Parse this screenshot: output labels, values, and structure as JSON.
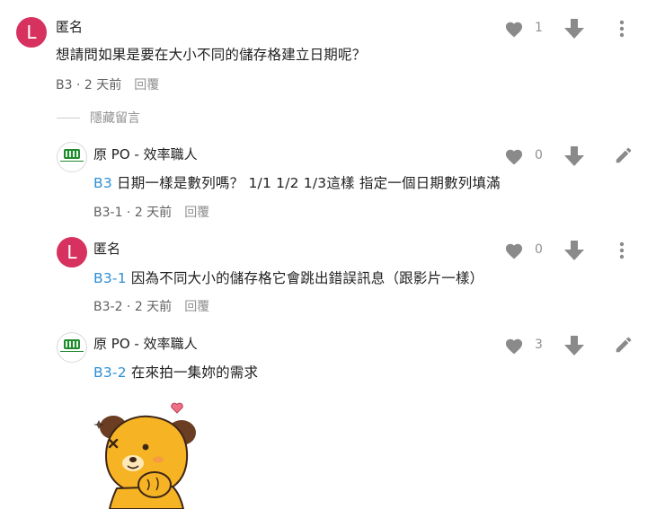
{
  "comments": [
    {
      "author": "匿名",
      "avatar_letter": "L",
      "text": "想請問如果是要在大小不同的儲存格建立日期呢？",
      "ref": "",
      "meta": "B3 · 2 天前",
      "reply": "回覆",
      "likes": "1"
    },
    {
      "author": "原 PO - 效率職人",
      "ref": "B3",
      "text": " 日期一樣是數列嗎？ 1/1 1/2 1/3這樣 指定一個日期數列填滿",
      "meta": "B3-1 · 2 天前",
      "reply": "回覆",
      "likes": "0"
    },
    {
      "author": "匿名",
      "avatar_letter": "L",
      "ref": "B3-1",
      "text": " 因為不同大小的儲存格它會跳出錯誤訊息（跟影片一樣）",
      "meta": "B3-2 · 2 天前",
      "reply": "回覆",
      "likes": "0"
    },
    {
      "author": "原 PO - 效率職人",
      "ref": "B3-2",
      "text": " 在來拍一集妳的需求",
      "likes": "3"
    }
  ],
  "hidden_comments_label": "隱藏留言",
  "icons": {
    "like": "heart-icon",
    "dislike": "arrow-down-icon",
    "more": "more-vertical-icon",
    "edit": "pencil-icon"
  },
  "colors": {
    "avatar": "#d6315f",
    "reference": "#2e90d4",
    "icon": "#8a8a8a"
  }
}
